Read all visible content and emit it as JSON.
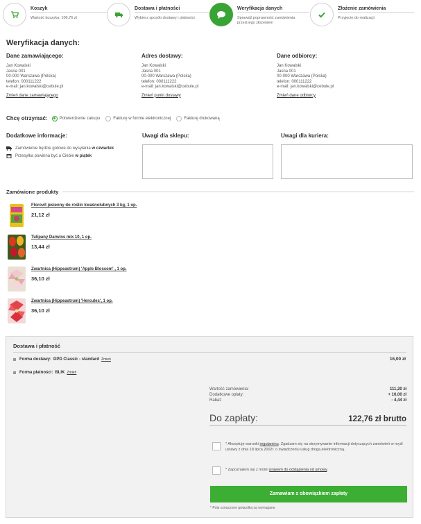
{
  "steps": [
    {
      "title": "Koszyk",
      "desc": [
        "Wartość koszyka: 106,76 zł"
      ],
      "icon": "cart-icon",
      "active": false
    },
    {
      "title": "Dostawa i płatności",
      "desc": [
        "Wybierz sposób dostawy i płatności"
      ],
      "icon": "truck-icon",
      "active": false
    },
    {
      "title": "Weryfikacja danych",
      "desc": [
        "Sprawdź poprawność zamówienia",
        "przed jego złożeniem"
      ],
      "icon": "chat-icon",
      "active": true
    },
    {
      "title": "Złożenie zamówienia",
      "desc": [
        "Przyjęcie do realizacji"
      ],
      "icon": "check-icon",
      "active": false
    }
  ],
  "page_title": "Weryfikacja danych:",
  "columns": [
    {
      "head": "Dane zamawiającego:",
      "lines": [
        "Jan Kowalski",
        "Jasna 001",
        "00-000 Warszawa (Polska)",
        "telefon: 000111222",
        "e-mail: jan.kowalski@cebule.pl"
      ],
      "link": "Zmień dane zamawiającego"
    },
    {
      "head": "Adres dostawy:",
      "lines": [
        "Jan Kowalski",
        "Jasna 001",
        "00-000 Warszawa (Polska)",
        "telefon: 000111222",
        "e-mail: jan.kowalski@cebule.pl"
      ],
      "link": "Zmień punkt dostawy"
    },
    {
      "head": "Dane odbiorcy:",
      "lines": [
        "Jan Kowalski",
        "Jasna 001",
        "00-000 Warszawa (Polska)",
        "telefon: 000111222",
        "e-mail: jan.kowalski@cebule.pl"
      ],
      "link": "Zmień dane odbiorcy"
    }
  ],
  "receive": {
    "label": "Chcę otrzymać:",
    "options": [
      "Potwierdzenie zakupu",
      "Fakturę w formie elektronicznej",
      "Fakturę drukowaną"
    ],
    "selected": 0
  },
  "info": {
    "head": "Dodatkowe informacje:",
    "items": [
      {
        "text": "Zamówienie będzie gotowe do wysyłania ",
        "bold": "w czwartek"
      },
      {
        "text": "Przesyłka powinna być u Ciebie ",
        "bold": "w piątek"
      }
    ]
  },
  "notes": {
    "shop": "Uwagi dla sklepu:",
    "courier": "Uwagi dla kuriera:"
  },
  "ordered_head": "Zamówione produkty",
  "products": [
    {
      "name": "Florovit jesienny do roślin kwaśnolubnych 3 kg, 1 op.",
      "price": "21,12 zł",
      "color": "#e8c21a"
    },
    {
      "name": "Tulipany Darwins mix 10, 1 op.",
      "price": "13,44 zł",
      "color": "#d83a1c"
    },
    {
      "name": "Zwartnica (Hippeastrum) 'Apple Blossom' , 1 op.",
      "price": "36,10 zł",
      "color": "#f2c8cf"
    },
    {
      "name": "Zwartnica (Hippeastrum) 'Hercules', 1 op.",
      "price": "36,10 zł",
      "color": "#e3434d"
    }
  ],
  "summary": {
    "head": "Dostawa i płatność",
    "delivery_key": "Forma dostawy:",
    "delivery_val": "DPD Classic - standard",
    "delivery_amount": "16,00 zł",
    "payment_key": "Forma płatności:",
    "payment_val": "BLIK",
    "change": "Zmień",
    "order_value_label": "Wartość zamówienia:",
    "order_value": "111,20 zł",
    "extra_label": "Dodatkowe opłaty:",
    "extra_value": "+ 16,00 zł",
    "discount_label": "Rabat:",
    "discount_value": "- 4,44 zł",
    "total_label": "Do zapłaty:",
    "total_value": "122,76 zł brutto",
    "agree1_pre": "* Akceptuję warunki ",
    "agree1_link": "regulaminu",
    "agree1_post": ". Zgadzam się na otrzymywanie informacji dotyczących zamówień w myśl ustawy z dnia 18 lipca 2002r. o świadczeniu usług drogą elektroniczną.",
    "agree2_pre": "* Zapoznałem się z moim ",
    "agree2_link": "prawem do odstąpienia od umowy",
    "agree2_post": ".",
    "submit": "Zamawiam z obowiązkiem zapłaty",
    "required_note": "* Pola oznaczone gwiazdką są wymagane."
  },
  "colors": {
    "accent": "#3aa335"
  }
}
